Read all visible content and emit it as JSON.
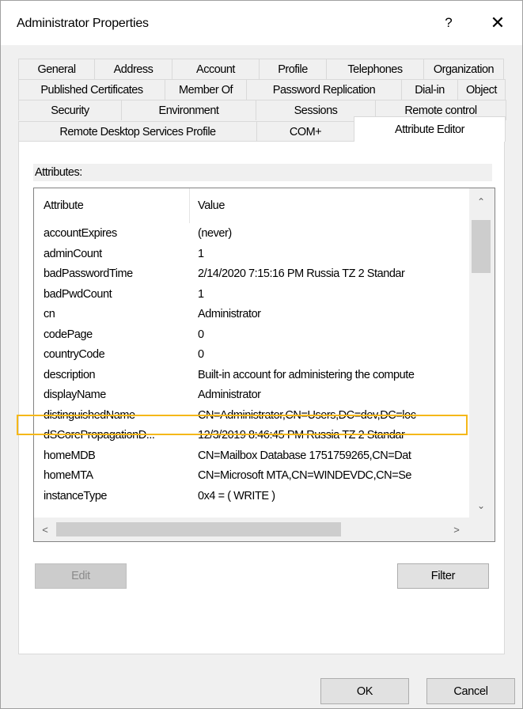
{
  "window": {
    "title": "Administrator Properties",
    "help_glyph": "?",
    "close_glyph": "✕"
  },
  "tabs": {
    "row1": [
      "General",
      "Address",
      "Account",
      "Profile",
      "Telephones",
      "Organization"
    ],
    "row2": [
      "Published Certificates",
      "Member Of",
      "Password Replication",
      "Dial-in",
      "Object"
    ],
    "row3": [
      "Security",
      "Environment",
      "Sessions",
      "Remote control"
    ],
    "row4": [
      "Remote Desktop Services Profile",
      "COM+",
      "Attribute Editor"
    ],
    "active": "Attribute Editor"
  },
  "attributes": {
    "label": "Attributes:",
    "columns": {
      "attribute": "Attribute",
      "value": "Value"
    },
    "rows": [
      {
        "attribute": "accountExpires",
        "value": "(never)"
      },
      {
        "attribute": "adminCount",
        "value": "1"
      },
      {
        "attribute": "badPasswordTime",
        "value": "2/14/2020 7:15:16 PM Russia TZ 2 Standar"
      },
      {
        "attribute": "badPwdCount",
        "value": "1"
      },
      {
        "attribute": "cn",
        "value": "Administrator"
      },
      {
        "attribute": "codePage",
        "value": "0"
      },
      {
        "attribute": "countryCode",
        "value": "0"
      },
      {
        "attribute": "description",
        "value": "Built-in account for administering the compute"
      },
      {
        "attribute": "displayName",
        "value": "Administrator"
      },
      {
        "attribute": "distinguishedName",
        "value": "CN=Administrator,CN=Users,DC=dev,DC=loc"
      },
      {
        "attribute": "dSCorePropagationD...",
        "value": "12/3/2019 8:46:45 PM Russia TZ 2 Standar"
      },
      {
        "attribute": "homeMDB",
        "value": "CN=Mailbox Database 1751759265,CN=Dat"
      },
      {
        "attribute": "homeMTA",
        "value": "CN=Microsoft MTA,CN=WINDEVDC,CN=Se"
      },
      {
        "attribute": "instanceType",
        "value": "0x4 = ( WRITE )"
      }
    ],
    "highlighted_row": "distinguishedName",
    "highlight_color": "#f5b819"
  },
  "buttons": {
    "edit": "Edit",
    "filter": "Filter",
    "ok": "OK",
    "cancel": "Cancel"
  },
  "scroll_icons": {
    "up": "⌃",
    "down": "⌄",
    "left": "<",
    "right": ">"
  }
}
